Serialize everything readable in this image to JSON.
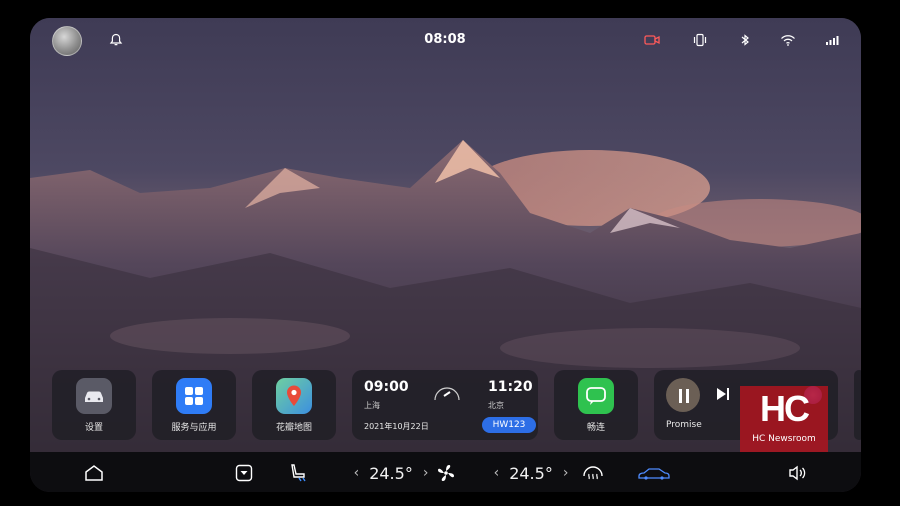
{
  "status_bar": {
    "time": "08:08",
    "icons": [
      "avatar",
      "bell-icon",
      "camera-icon",
      "vibrate-icon",
      "bluetooth-icon",
      "wifi-icon",
      "signal-icon"
    ]
  },
  "dock": {
    "apps": [
      {
        "name": "settings",
        "label": "设置",
        "icon": "car-icon",
        "color": "#5a5a66"
      },
      {
        "name": "services",
        "label": "服务与应用",
        "icon": "grid-icon",
        "color": "#2f7cf6"
      },
      {
        "name": "maps",
        "label": "花瓣地图",
        "icon": "map-pin-icon",
        "color": "#e84a3a"
      }
    ],
    "flight": {
      "depart_time": "09:00",
      "depart_city": "上海",
      "arrive_time": "11:20",
      "arrive_city": "北京",
      "date": "2021年10月22日",
      "flight_no": "HW123"
    },
    "chat": {
      "label": "畅连",
      "icon": "chat-icon",
      "color": "#2fc24f"
    },
    "music": {
      "label": "Promise",
      "icons": [
        "pause-icon",
        "next-icon"
      ]
    }
  },
  "bottom_bar": {
    "left_temp": "24.5°",
    "right_temp": "24.5°",
    "icons": [
      "home-icon",
      "down-arrow-icon",
      "seat-heat-icon",
      "fan-icon",
      "defrost-icon",
      "car-side-icon",
      "volume-icon"
    ]
  },
  "watermark": {
    "logo": "HC",
    "text": "HC Newsroom"
  }
}
